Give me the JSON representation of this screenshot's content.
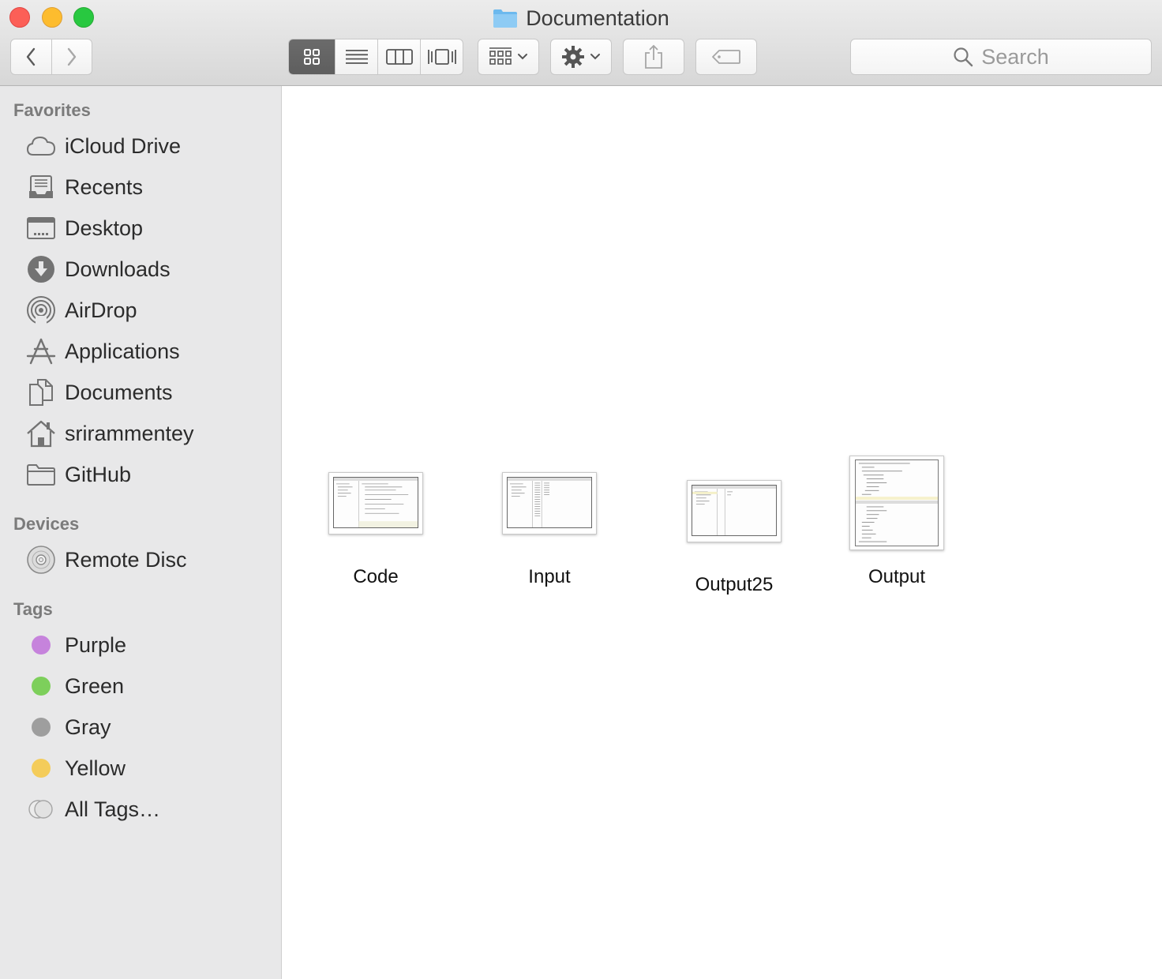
{
  "window": {
    "title": "Documentation",
    "icons": {
      "title_folder": "folder-icon"
    }
  },
  "toolbar": {
    "back": "chevron-left-icon",
    "forward": "chevron-right-icon",
    "views": [
      "icon-view-icon",
      "list-view-icon",
      "column-view-icon",
      "cover-flow-icon"
    ],
    "active_view": 0,
    "arrange": "arrange-grid-icon",
    "action": "gear-icon",
    "share": "share-icon",
    "tag": "tag-icon",
    "search_placeholder": "Search"
  },
  "sidebar": {
    "favorites_header": "Favorites",
    "favorites": [
      {
        "label": "iCloud Drive",
        "icon": "cloud-icon"
      },
      {
        "label": "Recents",
        "icon": "recents-icon"
      },
      {
        "label": "Desktop",
        "icon": "desktop-icon"
      },
      {
        "label": "Downloads",
        "icon": "download-icon"
      },
      {
        "label": "AirDrop",
        "icon": "airdrop-icon"
      },
      {
        "label": "Applications",
        "icon": "applications-icon"
      },
      {
        "label": "Documents",
        "icon": "documents-icon"
      },
      {
        "label": "srirammentey",
        "icon": "home-icon"
      },
      {
        "label": "GitHub",
        "icon": "folder-icon"
      }
    ],
    "devices_header": "Devices",
    "devices": [
      {
        "label": "Remote Disc",
        "icon": "disc-icon"
      }
    ],
    "tags_header": "Tags",
    "tags": [
      {
        "label": "Purple",
        "color": "#c683dc"
      },
      {
        "label": "Green",
        "color": "#7dcf5b"
      },
      {
        "label": "Gray",
        "color": "#9e9e9e"
      },
      {
        "label": "Yellow",
        "color": "#f4cc5a"
      },
      {
        "label": "All Tags…",
        "color": "#e0e0e0"
      }
    ]
  },
  "files": [
    {
      "name": "Code"
    },
    {
      "name": "Input"
    },
    {
      "name": "Output25"
    },
    {
      "name": "Output"
    }
  ]
}
